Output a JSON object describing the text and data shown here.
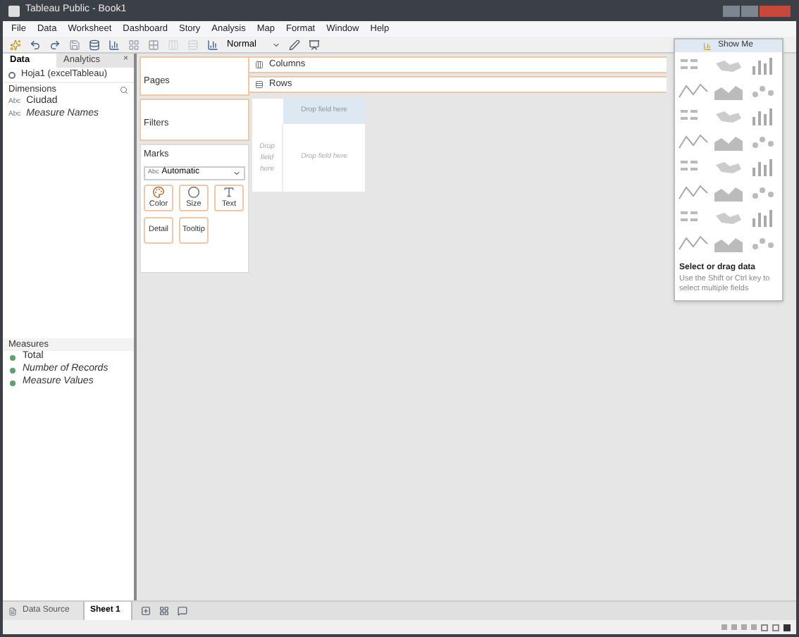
{
  "window": {
    "title": "Tableau Public - Book1"
  },
  "menu": [
    "File",
    "Data",
    "Worksheet",
    "Dashboard",
    "Story",
    "Analysis",
    "Map",
    "Format",
    "Window",
    "Help"
  ],
  "toolbar": {
    "fit": "Normal"
  },
  "data_pane": {
    "tabs": [
      {
        "label": "Data",
        "selected": true
      },
      {
        "label": "Analytics",
        "selected": false
      }
    ],
    "close": "×",
    "datasource": "Hoja1 (excelTableau)",
    "dimensions": {
      "title": "Dimensions",
      "items": [
        {
          "type": "Abc",
          "label": "Ciudad",
          "generated": false
        },
        {
          "type": "Abc",
          "label": "Measure Names",
          "generated": true
        }
      ]
    },
    "measures": {
      "title": "Measures",
      "items": [
        {
          "label": "Total",
          "generated": false
        },
        {
          "label": "Number of Records",
          "generated": true
        },
        {
          "label": "Measure Values",
          "generated": true
        }
      ]
    }
  },
  "cards": {
    "pages": "Pages",
    "filters": "Filters",
    "marks": {
      "title": "Marks",
      "type_icon": "Abc",
      "type": "Automatic",
      "buttons": [
        {
          "label": "Color",
          "kind": "color"
        },
        {
          "label": "Size",
          "kind": "size"
        },
        {
          "label": "Text",
          "kind": "text"
        },
        {
          "label": "Detail",
          "kind": "detail"
        },
        {
          "label": "Tooltip",
          "kind": "tooltip"
        }
      ]
    }
  },
  "shelves": [
    {
      "label": "Columns",
      "kind": "columns"
    },
    {
      "label": "Rows",
      "kind": "rows"
    }
  ],
  "view": {
    "top_hint": "Drop field here",
    "left_hint": "Drop field here",
    "center_hint": "Drop field here"
  },
  "show_me": {
    "title": "Show Me",
    "heading": "Select or drag data",
    "hint": "Use the Shift or Ctrl key to select multiple fields"
  },
  "sheet_tabs": [
    {
      "label": "Data Source",
      "kind": "datasource",
      "selected": false
    },
    {
      "label": "Sheet 1",
      "kind": "sheet",
      "selected": true
    }
  ]
}
